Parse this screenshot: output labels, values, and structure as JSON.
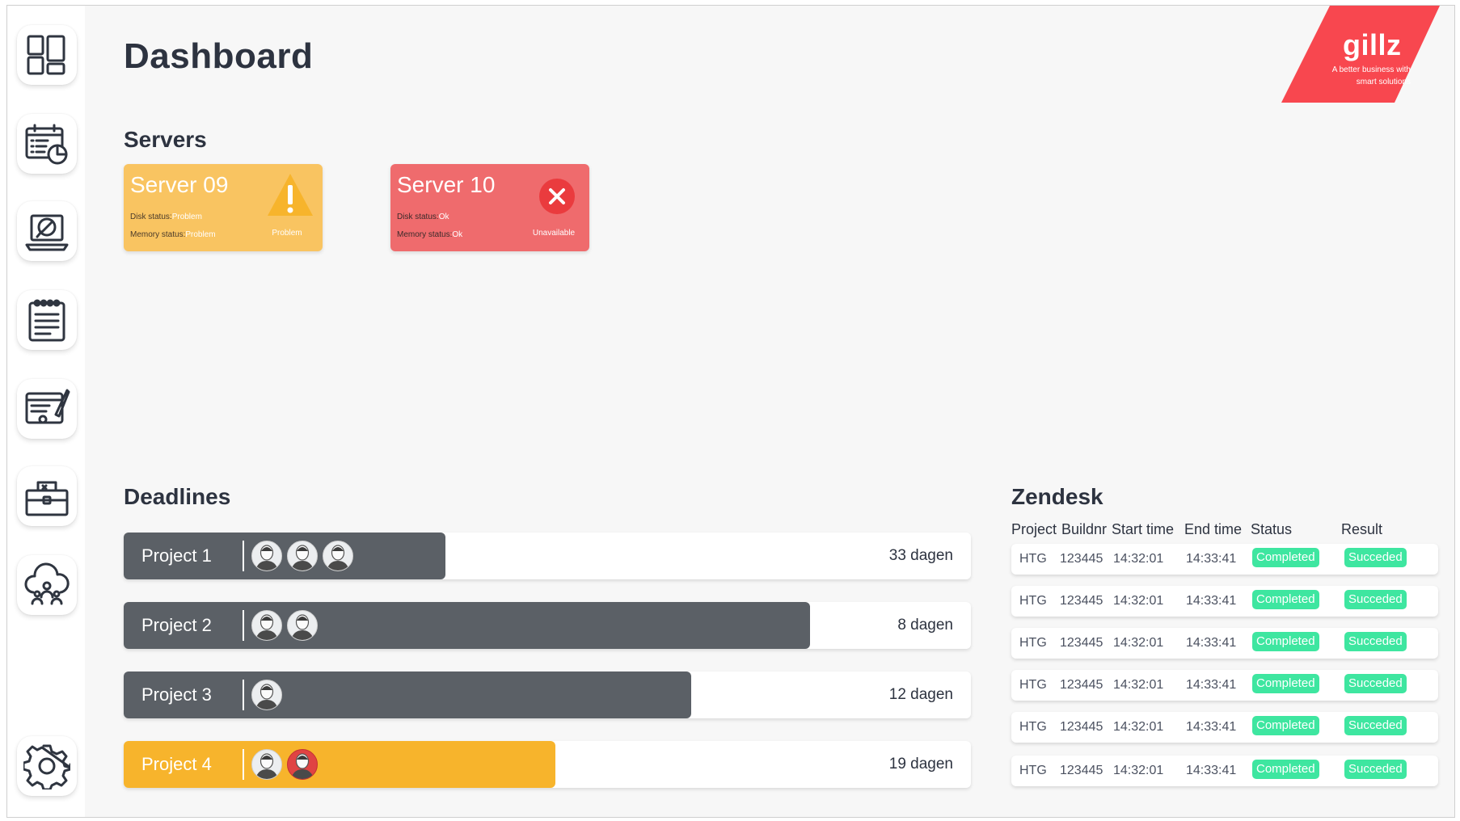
{
  "sidebar": {
    "items": [
      {
        "icon": "dashboard-icon"
      },
      {
        "icon": "calendar-chart-icon"
      },
      {
        "icon": "laptop-support-icon"
      },
      {
        "icon": "notepad-icon"
      },
      {
        "icon": "planning-board-icon"
      },
      {
        "icon": "toolbox-icon"
      },
      {
        "icon": "cloud-team-icon"
      },
      {
        "icon": "gear-icon"
      }
    ]
  },
  "header": {
    "title": "Dashboard"
  },
  "logo": {
    "word": "gillz",
    "tagline": "A better business with smart solutions",
    "color": "#f8474f"
  },
  "servers": {
    "title": "Servers",
    "cards": [
      {
        "name": "Server 09",
        "disk_label": "Disk status:",
        "disk_value": "Problem",
        "memory_label": "Memory status:",
        "memory_value": "Problem",
        "status": "Problem",
        "color": "#f9c461"
      },
      {
        "name": "Server 10",
        "disk_label": "Disk status:",
        "disk_value": "Ok",
        "memory_label": "Memory status:",
        "memory_value": "Ok",
        "status": "Unavailable",
        "color": "#ef6b6d"
      }
    ]
  },
  "deadlines": {
    "title": "Deadlines",
    "rows": [
      {
        "name": "Project 1",
        "days": "33 dagen",
        "progress": 0.38,
        "color": "#5b6066",
        "avatars": 3
      },
      {
        "name": "Project 2",
        "days": "8 dagen",
        "progress": 0.81,
        "color": "#5b6066",
        "avatars": 2
      },
      {
        "name": "Project 3",
        "days": "12 dagen",
        "progress": 0.67,
        "color": "#5b6066",
        "avatars": 1
      },
      {
        "name": "Project 4",
        "days": "19 dagen",
        "progress": 0.51,
        "color": "#f7b42c",
        "avatars": 2
      }
    ]
  },
  "zendesk": {
    "title": "Zendesk",
    "columns": [
      "Project",
      "Buildnr",
      "Start time",
      "End time",
      "Status",
      "Result"
    ],
    "rows": [
      {
        "project": "HTG",
        "buildnr": "123445",
        "start": "14:32:01",
        "end": "14:33:41",
        "status": "Completed",
        "result": "Succeded"
      },
      {
        "project": "HTG",
        "buildnr": "123445",
        "start": "14:32:01",
        "end": "14:33:41",
        "status": "Completed",
        "result": "Succeded"
      },
      {
        "project": "HTG",
        "buildnr": "123445",
        "start": "14:32:01",
        "end": "14:33:41",
        "status": "Completed",
        "result": "Succeded"
      },
      {
        "project": "HTG",
        "buildnr": "123445",
        "start": "14:32:01",
        "end": "14:33:41",
        "status": "Completed",
        "result": "Succeded"
      },
      {
        "project": "HTG",
        "buildnr": "123445",
        "start": "14:32:01",
        "end": "14:33:41",
        "status": "Completed",
        "result": "Succeded"
      },
      {
        "project": "HTG",
        "buildnr": "123445",
        "start": "14:32:01",
        "end": "14:33:41",
        "status": "Completed",
        "result": "Succeded"
      }
    ],
    "badge_color": "#3ee6a0"
  }
}
